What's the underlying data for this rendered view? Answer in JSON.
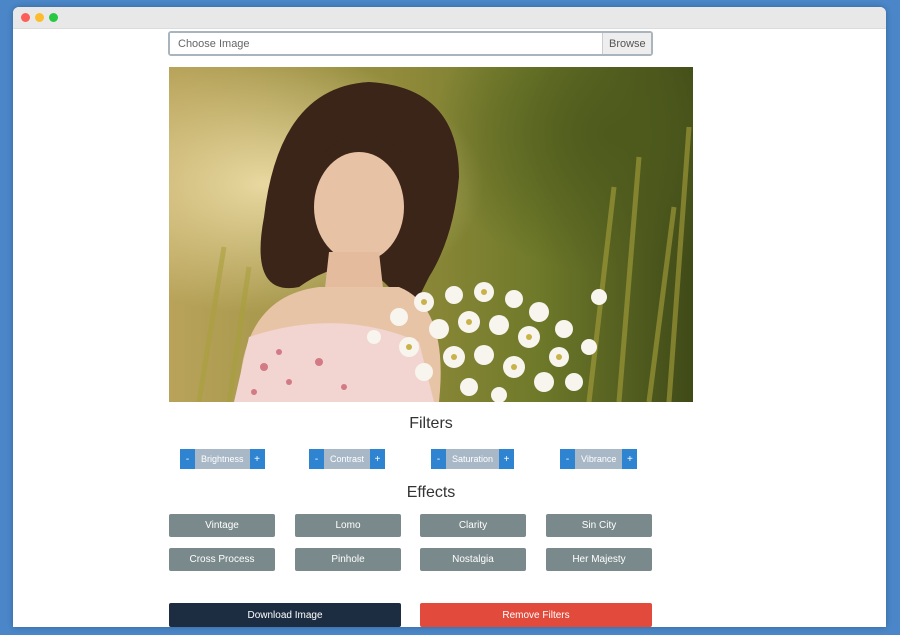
{
  "file": {
    "placeholder": "Choose Image",
    "browse_label": "Browse"
  },
  "filters": {
    "title": "Filters",
    "items": [
      {
        "minus": "-",
        "label": "Brightness",
        "plus": "+"
      },
      {
        "minus": "-",
        "label": "Contrast",
        "plus": "+"
      },
      {
        "minus": "-",
        "label": "Saturation",
        "plus": "+"
      },
      {
        "minus": "-",
        "label": "Vibrance",
        "plus": "+"
      }
    ]
  },
  "effects": {
    "title": "Effects",
    "buttons": [
      "Vintage",
      "Lomo",
      "Clarity",
      "Sin City",
      "Cross Process",
      "Pinhole",
      "Nostalgia",
      "Her Majesty"
    ]
  },
  "actions": {
    "download": "Download Image",
    "remove": "Remove Filters"
  },
  "colors": {
    "accent_blue": "#2e84d0",
    "effect_gray": "#7a8a8c",
    "download_bg": "#1d2d41",
    "remove_bg": "#e24a3b"
  }
}
